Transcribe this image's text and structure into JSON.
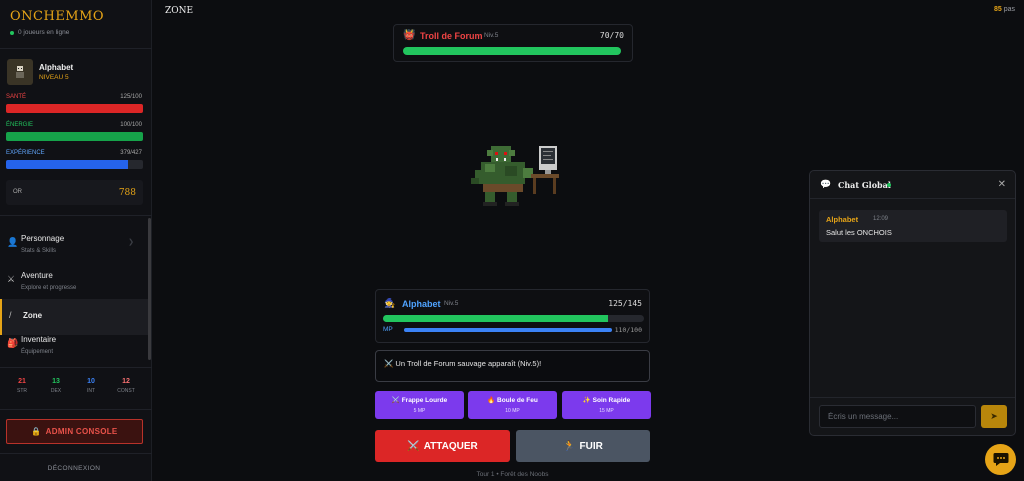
{
  "brand": "ONCHEMMO",
  "online_text": "0 joueurs en ligne",
  "player": {
    "name": "Alphabet",
    "level": "NIVEAU 5"
  },
  "stats": {
    "health": {
      "label": "SANTÉ",
      "value": "125/100",
      "fraction": 1.0,
      "color": "#dc2626"
    },
    "energy": {
      "label": "ÉNERGIE",
      "value": "100/100",
      "fraction": 1.0,
      "color": "#16a34a"
    },
    "xp": {
      "label": "EXPÉRIENCE",
      "value": "379/427",
      "fraction": 0.888,
      "color": "#2563eb"
    }
  },
  "gold": {
    "label": "OR",
    "value": "788"
  },
  "nav": {
    "personnage": {
      "title": "Personnage",
      "sub": "Stats & Skills",
      "icon": "person-icon"
    },
    "aventure": {
      "title": "Aventure",
      "sub": "Explore et progresse",
      "icon": "swords-icon"
    },
    "zone": {
      "title": "Zone",
      "icon": "sword-icon"
    },
    "inventaire": {
      "title": "Inventaire",
      "sub": "Équipement",
      "icon": "backpack-icon"
    }
  },
  "attributes": [
    {
      "value": "21",
      "name": "STR",
      "color": "#ef4444"
    },
    {
      "value": "13",
      "name": "DEX",
      "color": "#22c55e"
    },
    {
      "value": "10",
      "name": "INT",
      "color": "#3b82f6"
    },
    {
      "value": "12",
      "name": "CONST",
      "color": "#f87171"
    }
  ],
  "admin_label": "ADMIN CONSOLE",
  "logout_label": "DÉCONNEXION",
  "topbar": {
    "title": "ZONE",
    "steps_value": "85",
    "steps_unit": "pas"
  },
  "enemy": {
    "name": "Troll de Forum",
    "level": "Niv.5",
    "hp": "70/70",
    "hp_fraction": 1.0
  },
  "combat_player": {
    "name": "Alphabet",
    "level": "Niv.5",
    "hp": "125/145",
    "hp_fraction": 0.862,
    "mp_label": "MP",
    "mp": "110/100",
    "mp_fraction": 1.0
  },
  "log": "⚔️ Un Troll de Forum sauvage apparaît (Niv.5)!",
  "skills": [
    {
      "name": "⚔️ Frappe Lourde",
      "cost": "5 MP"
    },
    {
      "name": "🔥 Boule de Feu",
      "cost": "10 MP"
    },
    {
      "name": "✨ Soin Rapide",
      "cost": "15 MP"
    }
  ],
  "attack_label": "ATTAQUER",
  "flee_label": "FUIR",
  "turn_info": "Tour 1 • Forêt des Noobs",
  "chat": {
    "title": "Chat Global",
    "messages": [
      {
        "user": "Alphabet",
        "time": "12:09",
        "text": "Salut les ONCHOIS"
      }
    ],
    "placeholder": "Écris un message..."
  }
}
